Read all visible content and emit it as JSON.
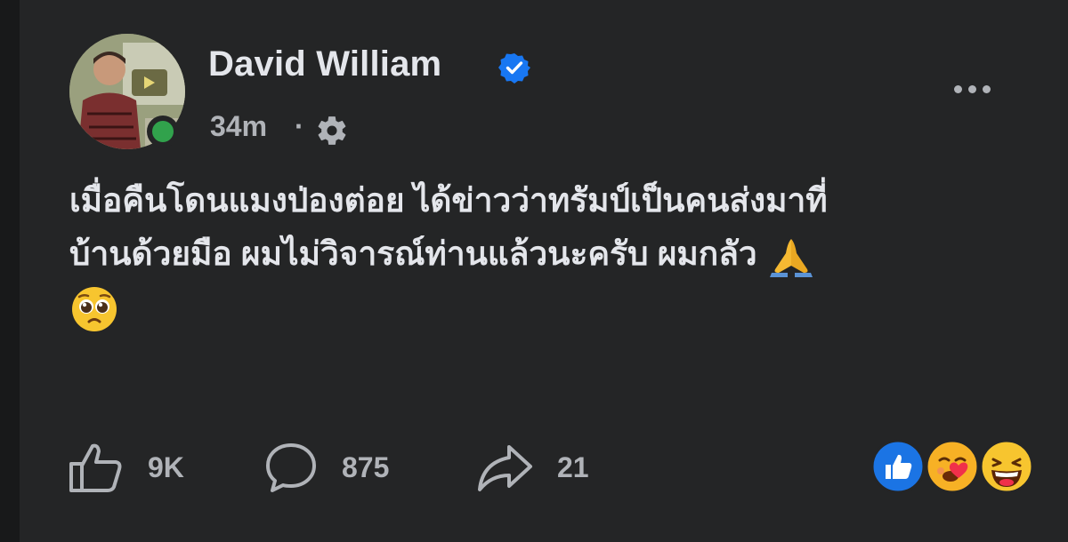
{
  "post": {
    "author_name": "David William",
    "timestamp": "34m",
    "separator": "·",
    "text_line1": "เมื่อคืนโดนแมงป่องต่อย ได้ข่าวว่าทรัมป์เป็นคนส่งมาที่",
    "text_line2": "บ้านด้วยมือ ผมไม่วิจารณ์ท่านแล้วนะครับ ผมกลัว",
    "emoji_1": "folded-hands",
    "emoji_2": "pleading-face"
  },
  "icons": {
    "verified": "verified-badge-icon",
    "privacy": "gear-icon",
    "more": "more-icon",
    "like": "thumbs-up-icon",
    "comment": "comment-bubble-icon",
    "share": "share-arrow-icon"
  },
  "actions": {
    "like_count": "9K",
    "comment_count": "875",
    "share_count": "21"
  },
  "reactions": [
    "like",
    "love-heart-face",
    "laughing"
  ],
  "colors": {
    "background": "#242526",
    "text": "#e4e6eb",
    "secondary_text": "#b0b3b8",
    "verified_blue": "#1877f2",
    "online_green": "#31a24c"
  }
}
